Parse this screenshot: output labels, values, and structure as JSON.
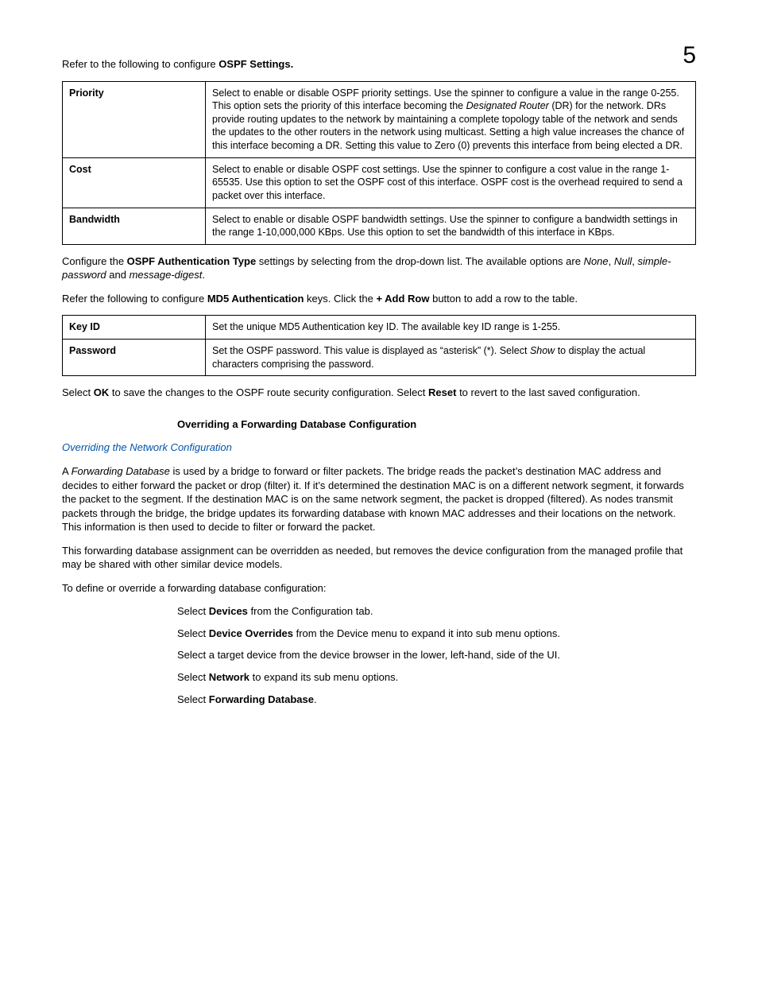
{
  "chapter_number": "5",
  "intro_prefix": "Refer to the following to configure ",
  "intro_bold": "OSPF Settings.",
  "ospf_table": {
    "rows": [
      {
        "label": "Priority",
        "desc_parts": [
          {
            "t": "Select to enable or disable OSPF priority settings. Use the spinner to configure a value in the range 0-255. This option sets the priority of this interface becoming the "
          },
          {
            "t": "Designated Router",
            "style": "italic"
          },
          {
            "t": " (DR) for the network. DRs provide routing updates to the network by maintaining a complete topology table of the network and sends the updates to the other routers in the network using multicast. Setting a high value increases the chance of this interface becoming a DR. Setting this value to Zero (0) prevents this interface from being elected a DR."
          }
        ]
      },
      {
        "label": "Cost",
        "desc_parts": [
          {
            "t": "Select to enable or disable OSPF cost settings. Use the spinner to configure a cost value in the range 1-65535. Use this option to set the OSPF cost of this interface. OSPF cost is the overhead required to send a packet over this interface."
          }
        ]
      },
      {
        "label": "Bandwidth",
        "desc_parts": [
          {
            "t": "Select to enable or disable OSPF bandwidth settings. Use the spinner to configure a bandwidth settings in the range 1-10,000,000 KBps. Use this option to set the bandwidth of this interface in KBps."
          }
        ]
      }
    ]
  },
  "auth_para_parts": [
    {
      "t": "Configure the "
    },
    {
      "t": "OSPF Authentication Type",
      "style": "bold"
    },
    {
      "t": " settings by selecting from the drop-down list. The available options are "
    },
    {
      "t": "None",
      "style": "italic"
    },
    {
      "t": ", "
    },
    {
      "t": "Null",
      "style": "italic"
    },
    {
      "t": ", "
    },
    {
      "t": "simple-password",
      "style": "italic"
    },
    {
      "t": " and "
    },
    {
      "t": "message-digest",
      "style": "italic"
    },
    {
      "t": "."
    }
  ],
  "md5_para_parts": [
    {
      "t": "Refer the following to configure "
    },
    {
      "t": "MD5 Authentication",
      "style": "bold"
    },
    {
      "t": " keys. Click the "
    },
    {
      "t": "+ Add Row",
      "style": "bold"
    },
    {
      "t": " button to add a row to the table."
    }
  ],
  "md5_table": {
    "rows": [
      {
        "label": "Key ID",
        "desc_parts": [
          {
            "t": "Set the unique MD5 Authentication key ID. The available key ID range is 1-255."
          }
        ]
      },
      {
        "label": "Password",
        "desc_parts": [
          {
            "t": "Set the OSPF password. This value is displayed as “asterisk” (*). Select "
          },
          {
            "t": "Show",
            "style": "italic"
          },
          {
            "t": " to display the actual characters comprising the password."
          }
        ]
      }
    ]
  },
  "save_para_parts": [
    {
      "t": "Select "
    },
    {
      "t": "OK",
      "style": "bold"
    },
    {
      "t": " to save the changes to the OSPF route security configuration. Select "
    },
    {
      "t": "Reset",
      "style": "bold"
    },
    {
      "t": " to revert to the last saved configuration."
    }
  ],
  "section_heading": "Overriding a Forwarding Database Configuration",
  "section_link": "Overriding the Network Configuration",
  "fd_para1_parts": [
    {
      "t": "A "
    },
    {
      "t": "Forwarding Database",
      "style": "italic"
    },
    {
      "t": " is used by a bridge to forward or filter packets. The bridge reads the packet’s destination MAC address and decides to either forward the packet or drop (filter) it. If it’s determined the destination MAC is on a different network segment, it forwards the packet to the segment. If the destination MAC is on the same network segment, the packet is dropped (filtered). As nodes transmit packets through the bridge, the bridge updates its forwarding database with known MAC addresses and their locations on the network. This information is then used to decide to filter or forward the packet."
    }
  ],
  "fd_para2": "This forwarding database assignment can be overridden as needed, but removes the device configuration from the managed profile that may be shared with other similar device models.",
  "fd_para3": "To define or override a forwarding database configuration:",
  "steps": [
    {
      "parts": [
        {
          "t": "Select "
        },
        {
          "t": "Devices",
          "style": "bold"
        },
        {
          "t": " from the Configuration tab."
        }
      ]
    },
    {
      "parts": [
        {
          "t": "Select "
        },
        {
          "t": "Device Overrides",
          "style": "bold"
        },
        {
          "t": " from the Device menu to expand it into sub menu options."
        }
      ]
    },
    {
      "parts": [
        {
          "t": "Select a target device from the device browser in the lower, left-hand, side of the UI."
        }
      ]
    },
    {
      "parts": [
        {
          "t": "Select "
        },
        {
          "t": "Network",
          "style": "bold"
        },
        {
          "t": " to expand its sub menu options."
        }
      ]
    },
    {
      "parts": [
        {
          "t": "Select "
        },
        {
          "t": "Forwarding Database",
          "style": "bold"
        },
        {
          "t": "."
        }
      ]
    }
  ]
}
